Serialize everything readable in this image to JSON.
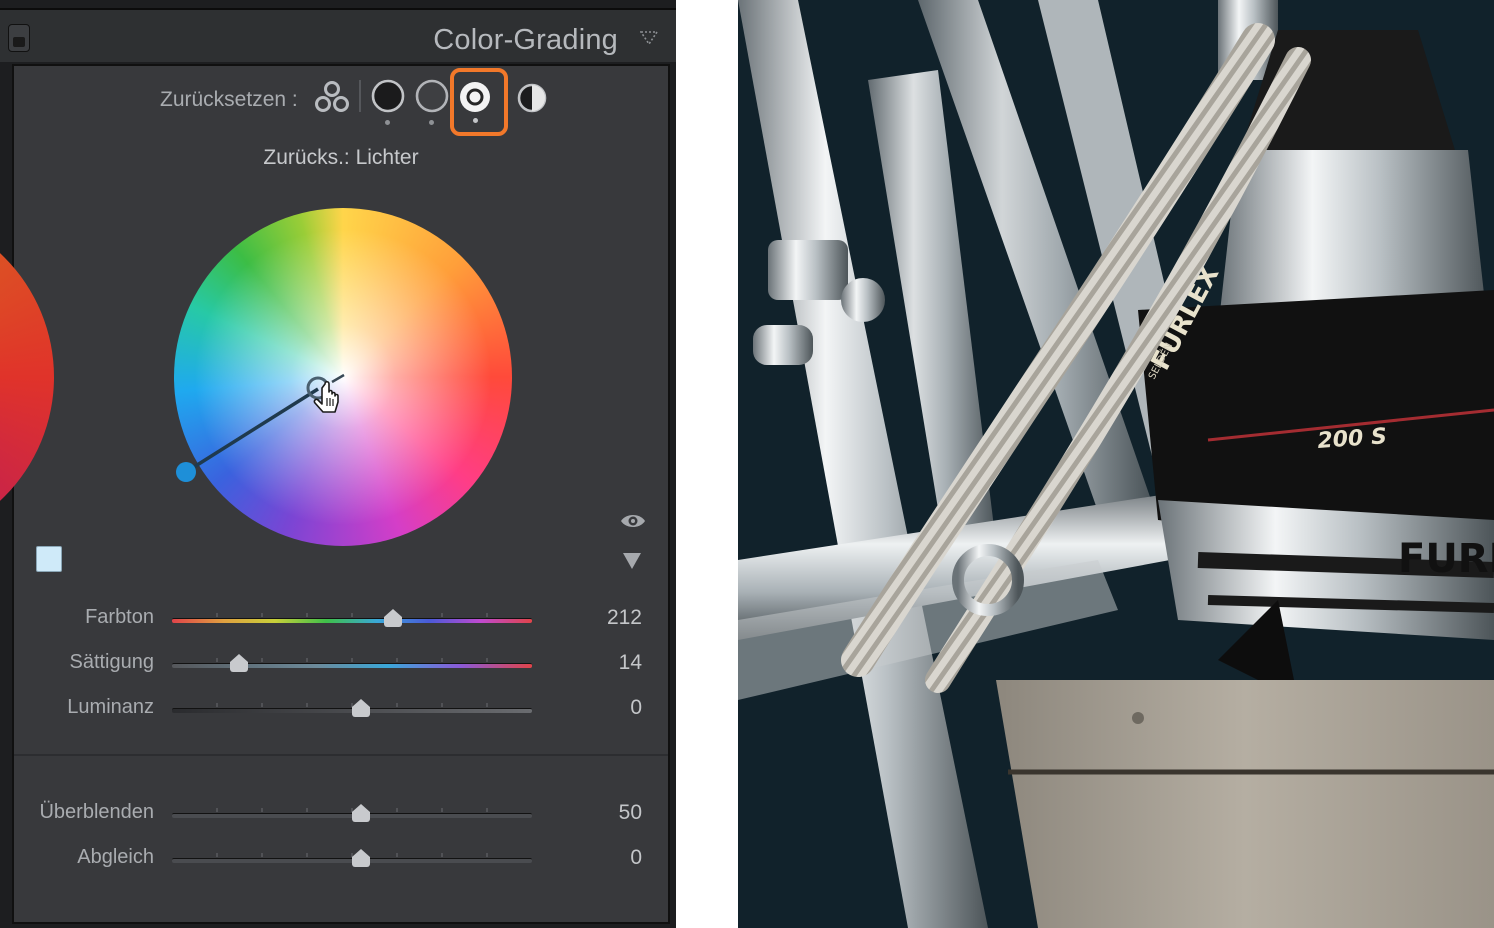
{
  "panel": {
    "title": "Color-Grading",
    "reset_label": "Zurücksetzen :",
    "active_label": "Zurücks.: Lichter",
    "modes": [
      {
        "name": "3-wege",
        "icon": "three-circles-icon"
      },
      {
        "name": "tiefen",
        "icon": "dark-circle-icon"
      },
      {
        "name": "mitteltöne",
        "icon": "hollow-circle-icon"
      },
      {
        "name": "lichter",
        "icon": "light-circle-icon",
        "active": true
      },
      {
        "name": "global",
        "icon": "half-circle-icon"
      }
    ],
    "highlight_color": "#f2782a",
    "swatch_color": "#cfeaf9",
    "wheel_handle_color": "#1e8fd8"
  },
  "sliders": {
    "hue": {
      "label": "Farbton",
      "value": "212",
      "fraction": 0.59
    },
    "saturation": {
      "label": "Sättigung",
      "value": "14",
      "fraction": 0.16
    },
    "luminance": {
      "label": "Luminanz",
      "value": "0",
      "fraction": 0.5
    },
    "blending": {
      "label": "Überblenden",
      "value": "50",
      "fraction": 0.5
    },
    "balance": {
      "label": "Abgleich",
      "value": "0",
      "fraction": 0.5
    }
  },
  "photo": {
    "brand_label": "FURLEX",
    "sub_brand": "SELDÉN",
    "model": "200 S",
    "brand_partial": "FURL"
  }
}
